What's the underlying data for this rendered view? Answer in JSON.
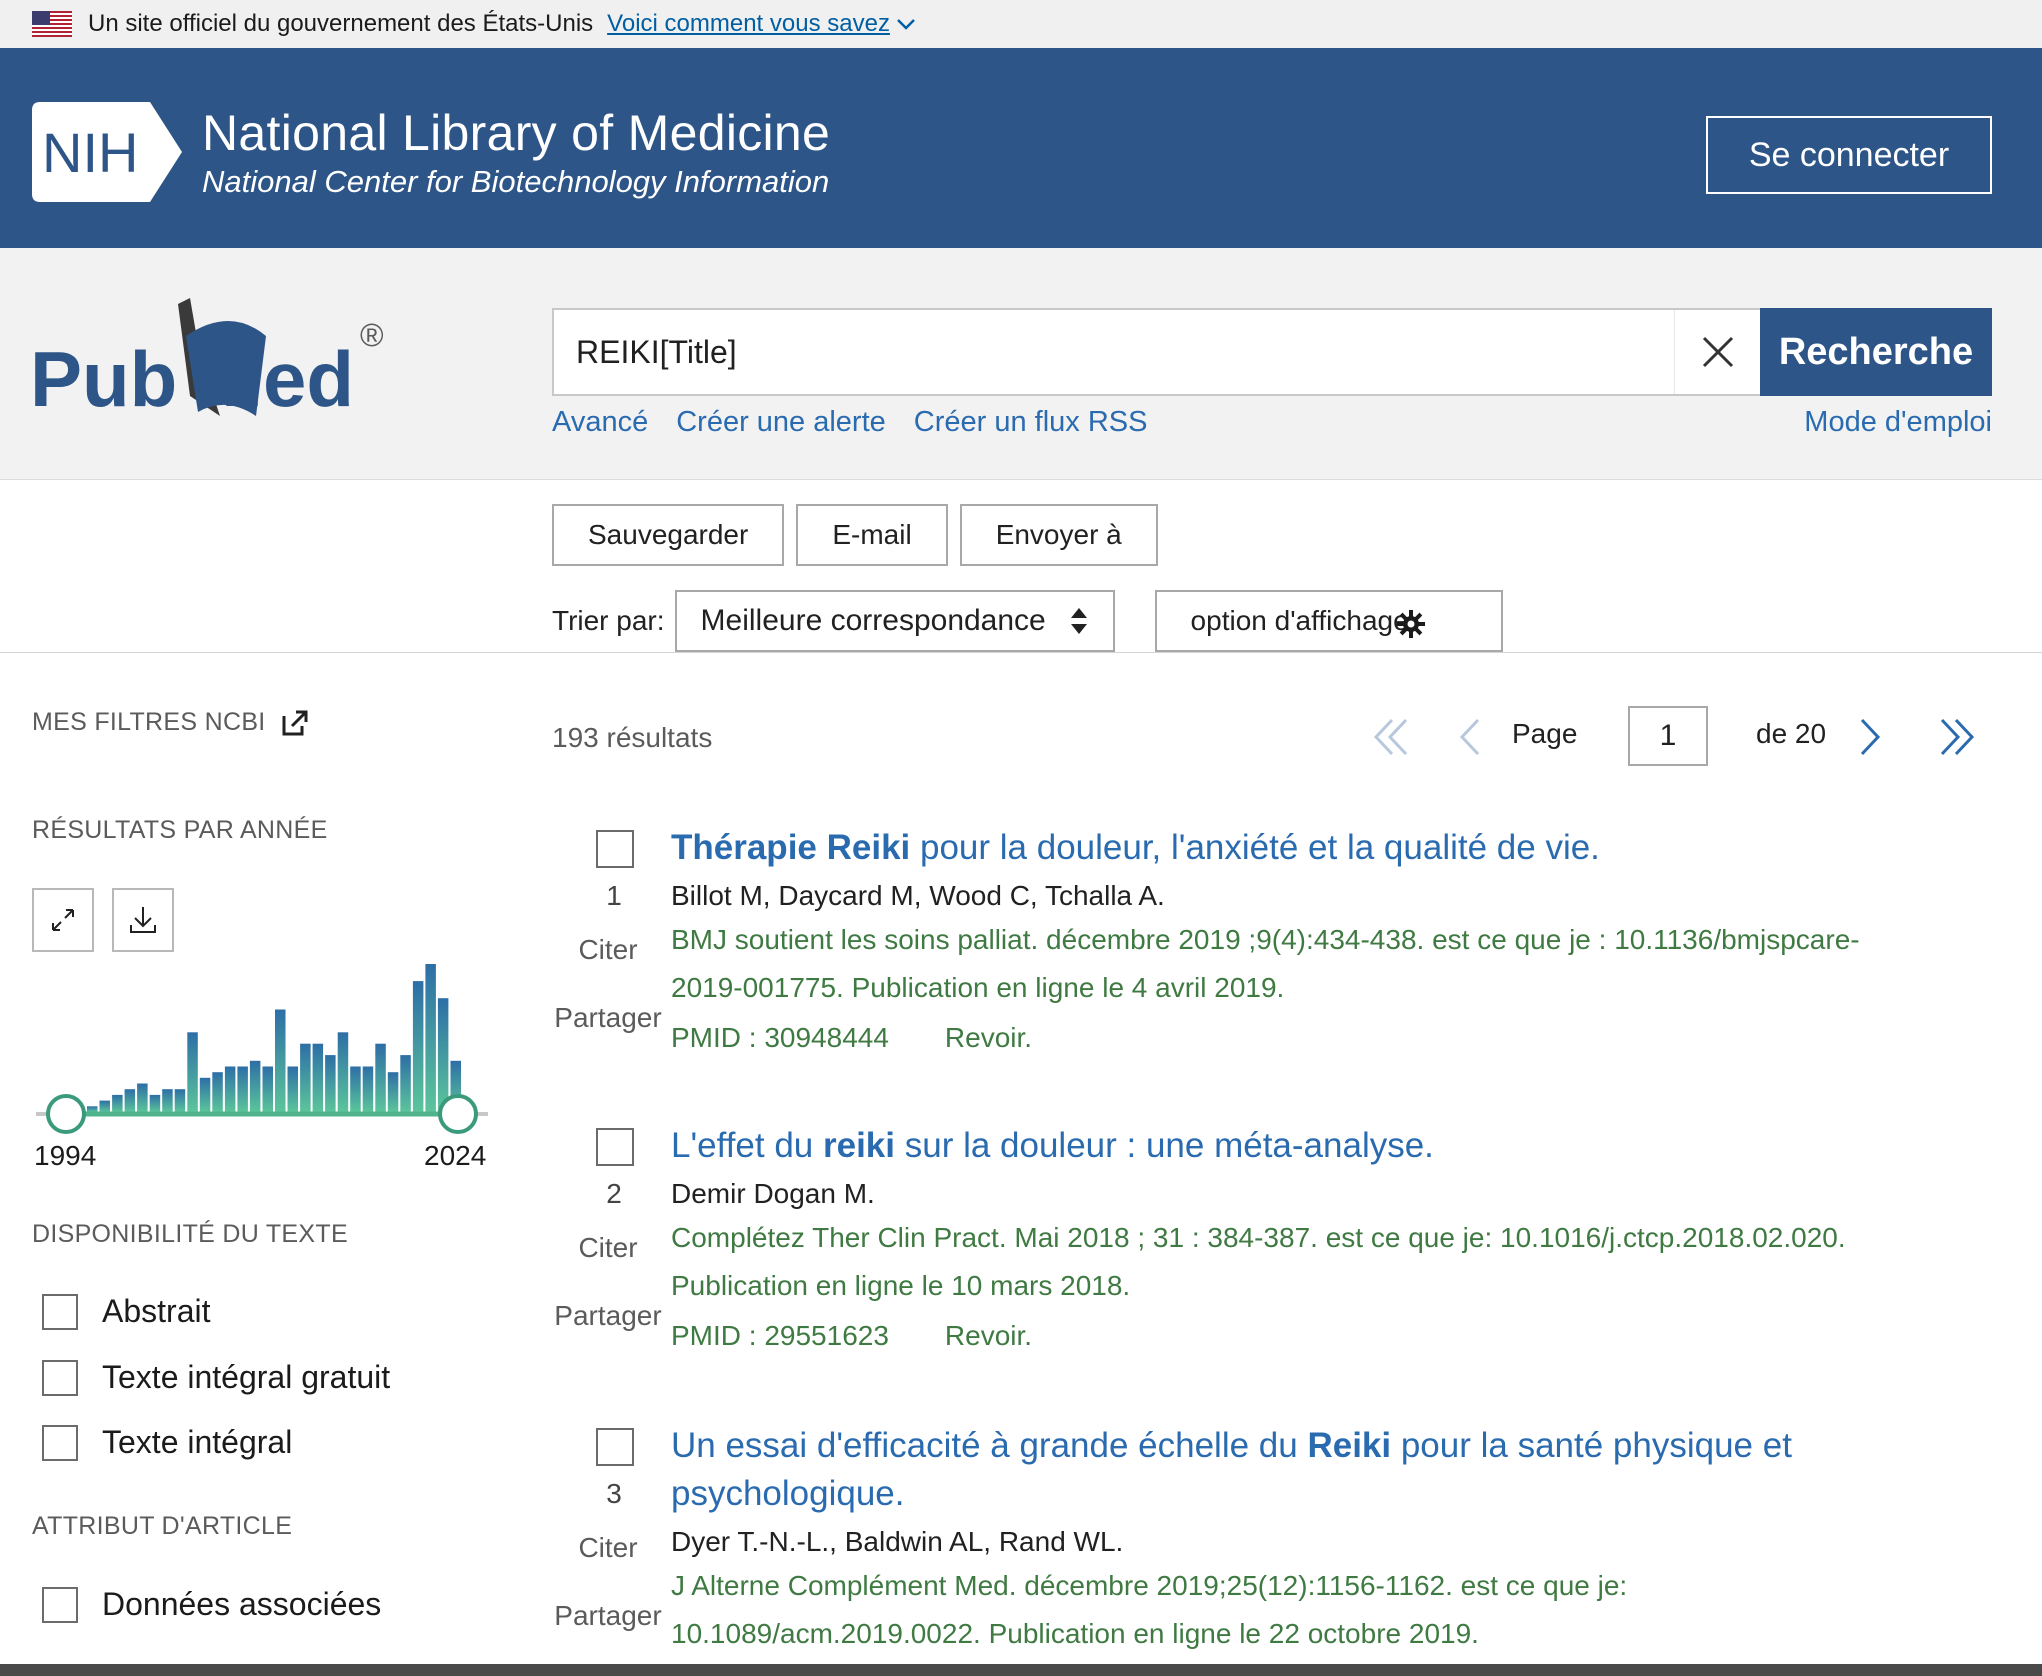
{
  "gov_banner": {
    "text": "Un site officiel du gouvernement des États-Unis",
    "link": "Voici comment vous savez"
  },
  "nih": {
    "logo_text": "NIH",
    "title": "National Library of Medicine",
    "subtitle": "National Center for Biotechnology Information",
    "login": "Se connecter"
  },
  "pubmed": {
    "logo_pub": "Pub",
    "logo_med": "Med",
    "logo_reg": "®"
  },
  "search": {
    "value": "REIKI[Title]",
    "button": "Recherche",
    "links": [
      "Avancé",
      "Créer une alerte",
      "Créer un flux RSS"
    ],
    "help": "Mode d'emploi"
  },
  "actions": [
    "Sauvegarder",
    "E-mail",
    "Envoyer à"
  ],
  "sort": {
    "label": "Trier par:",
    "value": "Meilleure correspondance",
    "display": "option d'affichage"
  },
  "sidebar": {
    "my_filters": "MES FILTRES NCBI",
    "by_year": "RÉSULTATS PAR ANNÉE",
    "year_start": "1994",
    "year_end": "2024",
    "text_availability": "DISPONIBILITÉ DU TEXTE",
    "text_filters": [
      "Abstrait",
      "Texte intégral gratuit",
      "Texte intégral"
    ],
    "article_attribute": "ATTRIBUT D'ARTICLE",
    "attribute_filters": [
      "Données associées"
    ]
  },
  "year_histogram": {
    "values": [
      1,
      2,
      3,
      4,
      5,
      3,
      4,
      4,
      14,
      6,
      7,
      8,
      8,
      9,
      8,
      18,
      8,
      12,
      12,
      10,
      14,
      8,
      8,
      12,
      7,
      10,
      23,
      26,
      20,
      9
    ],
    "colors": {
      "low": "#5bc59b",
      "high": "#2d6ea6"
    }
  },
  "results": {
    "count": "193 résultats",
    "page_label": "Page",
    "page_value": "1",
    "page_of": "de 20",
    "items": [
      {
        "num": "1",
        "title_bold": "Thérapie Reiki",
        "title_rest": " pour la douleur, l'anxiété et la qualité de vie.",
        "authors": "Billot M, Daycard M, Wood C, Tchalla A.",
        "citation_1": "BMJ soutient les soins palliat. décembre 2019 ;9(4):434-438. est ce que je : 10.1136/bmjspcare-",
        "citation_2": "2019-001775. Publication en ligne le 4 avril 2019.",
        "pmid": "PMID : 30948444",
        "type": "Revoir.",
        "cite": "Citer",
        "share": "Partager"
      },
      {
        "num": "2",
        "title_pre": "L'effet du ",
        "title_bold": "reiki",
        "title_rest": " sur la douleur : une méta-analyse.",
        "authors": "Demir Dogan M.",
        "citation_1": "Complétez Ther Clin Pract. Mai 2018 ; 31 : 384-387. est ce que je: 10.1016/j.ctcp.2018.02.020.",
        "citation_2": "Publication en ligne le 10 mars 2018.",
        "pmid": "PMID : 29551623",
        "type": "Revoir.",
        "cite": "Citer",
        "share": "Partager"
      },
      {
        "num": "3",
        "title_pre": "Un essai d'efficacité à grande échelle du ",
        "title_bold": "Reiki",
        "title_rest": " pour la santé physique et",
        "title_line2": "psychologique.",
        "authors": "Dyer T.-N.-L., Baldwin AL, Rand WL.",
        "citation_1": "J Alterne Complément Med. décembre 2019;25(12):1156-1162. est ce que je:",
        "citation_2": "10.1089/acm.2019.0022. Publication en ligne le 22 octobre 2019.",
        "cite": "Citer",
        "share": "Partager"
      }
    ]
  }
}
